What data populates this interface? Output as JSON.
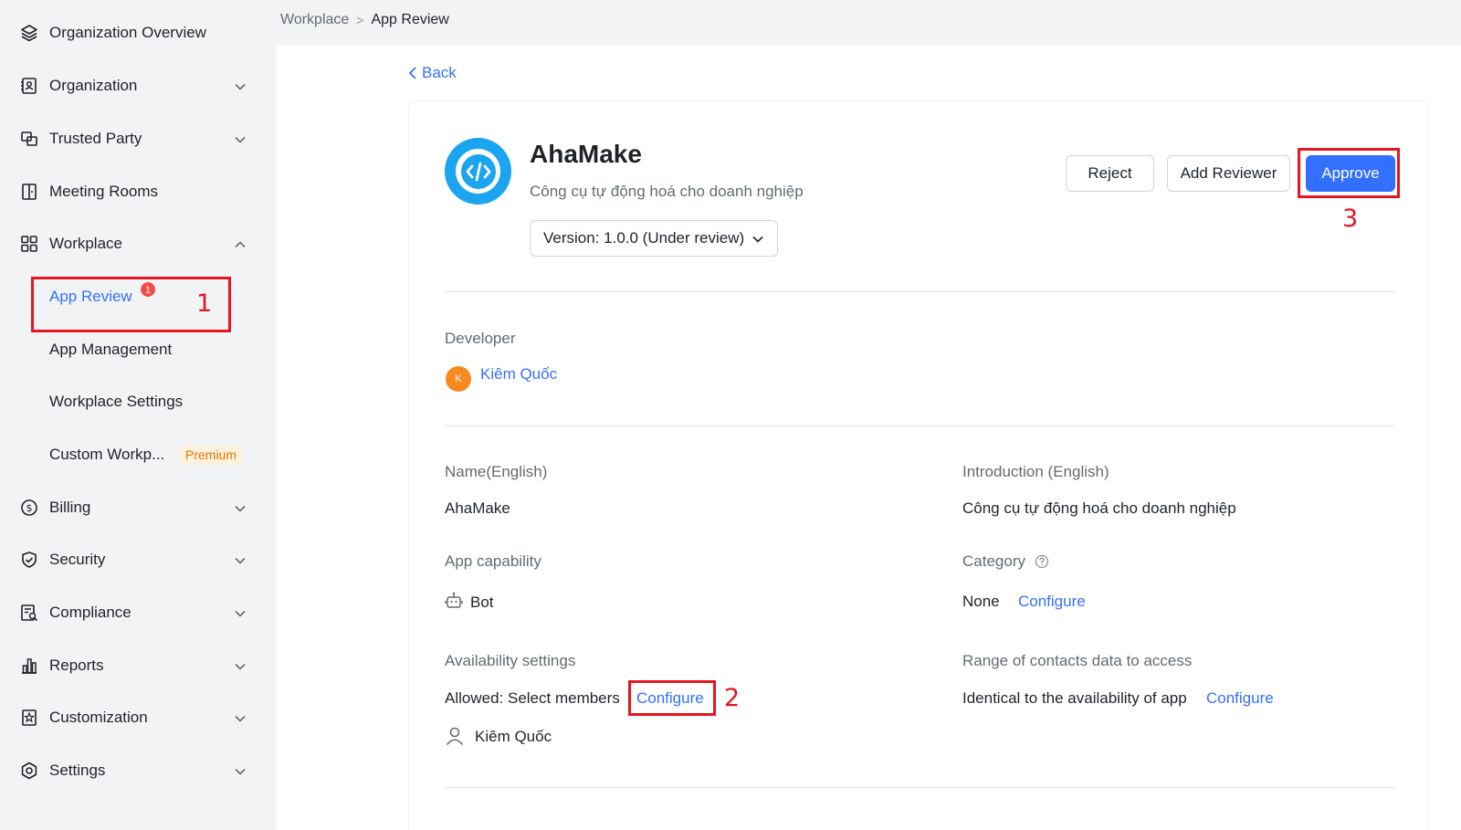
{
  "sidebar": {
    "items": [
      {
        "label": "Organization Overview",
        "icon": "layers-icon"
      },
      {
        "label": "Organization",
        "icon": "contact-card-icon"
      },
      {
        "label": "Trusted Party",
        "icon": "trusted-party-icon"
      },
      {
        "label": "Meeting Rooms",
        "icon": "door-icon"
      },
      {
        "label": "Workplace",
        "icon": "grid-icon"
      },
      {
        "label": "Billing",
        "icon": "dollar-circle-icon"
      },
      {
        "label": "Security",
        "icon": "shield-check-icon"
      },
      {
        "label": "Compliance",
        "icon": "document-search-icon"
      },
      {
        "label": "Reports",
        "icon": "bar-chart-icon"
      },
      {
        "label": "Customization",
        "icon": "customize-icon"
      },
      {
        "label": "Settings",
        "icon": "gear-icon"
      }
    ],
    "workplace_sub": [
      {
        "label": "App Review",
        "badge": "1"
      },
      {
        "label": "App Management"
      },
      {
        "label": "Workplace Settings"
      },
      {
        "label": "Custom Workp...",
        "tag": "Premium"
      }
    ]
  },
  "breadcrumb": {
    "parent": "Workplace",
    "separator": ">",
    "current": "App Review"
  },
  "back_label": "Back",
  "app": {
    "name": "AhaMake",
    "description": "Công cụ tự động hoá cho doanh nghiệp",
    "version_label": "Version: 1.0.0 (Under review)"
  },
  "actions": {
    "reject": "Reject",
    "add_reviewer": "Add Reviewer",
    "approve": "Approve"
  },
  "developer": {
    "label": "Developer",
    "avatar_initial": "K",
    "name": "Kiêm Quốc"
  },
  "details": {
    "name_label": "Name(English)",
    "name_value": "AhaMake",
    "intro_label": "Introduction (English)",
    "intro_value": "Công cụ tự động hoá cho doanh nghiệp",
    "capability_label": "App capability",
    "capability_value": "Bot",
    "category_label": "Category",
    "category_value": "None",
    "category_link": "Configure",
    "availability_label": "Availability settings",
    "availability_value": "Allowed: Select members",
    "availability_link": "Configure",
    "availability_member": "Kiêm Quốc",
    "contacts_label": "Range of contacts data to access",
    "contacts_value": "Identical to the availability of app",
    "contacts_link": "Configure"
  },
  "annotations": {
    "one": "1",
    "two": "2",
    "three": "3"
  },
  "colors": {
    "accent": "#3370ff",
    "annotation": "#e6151f",
    "badge": "#f54a45",
    "app_logo": "#1ba4ef"
  }
}
